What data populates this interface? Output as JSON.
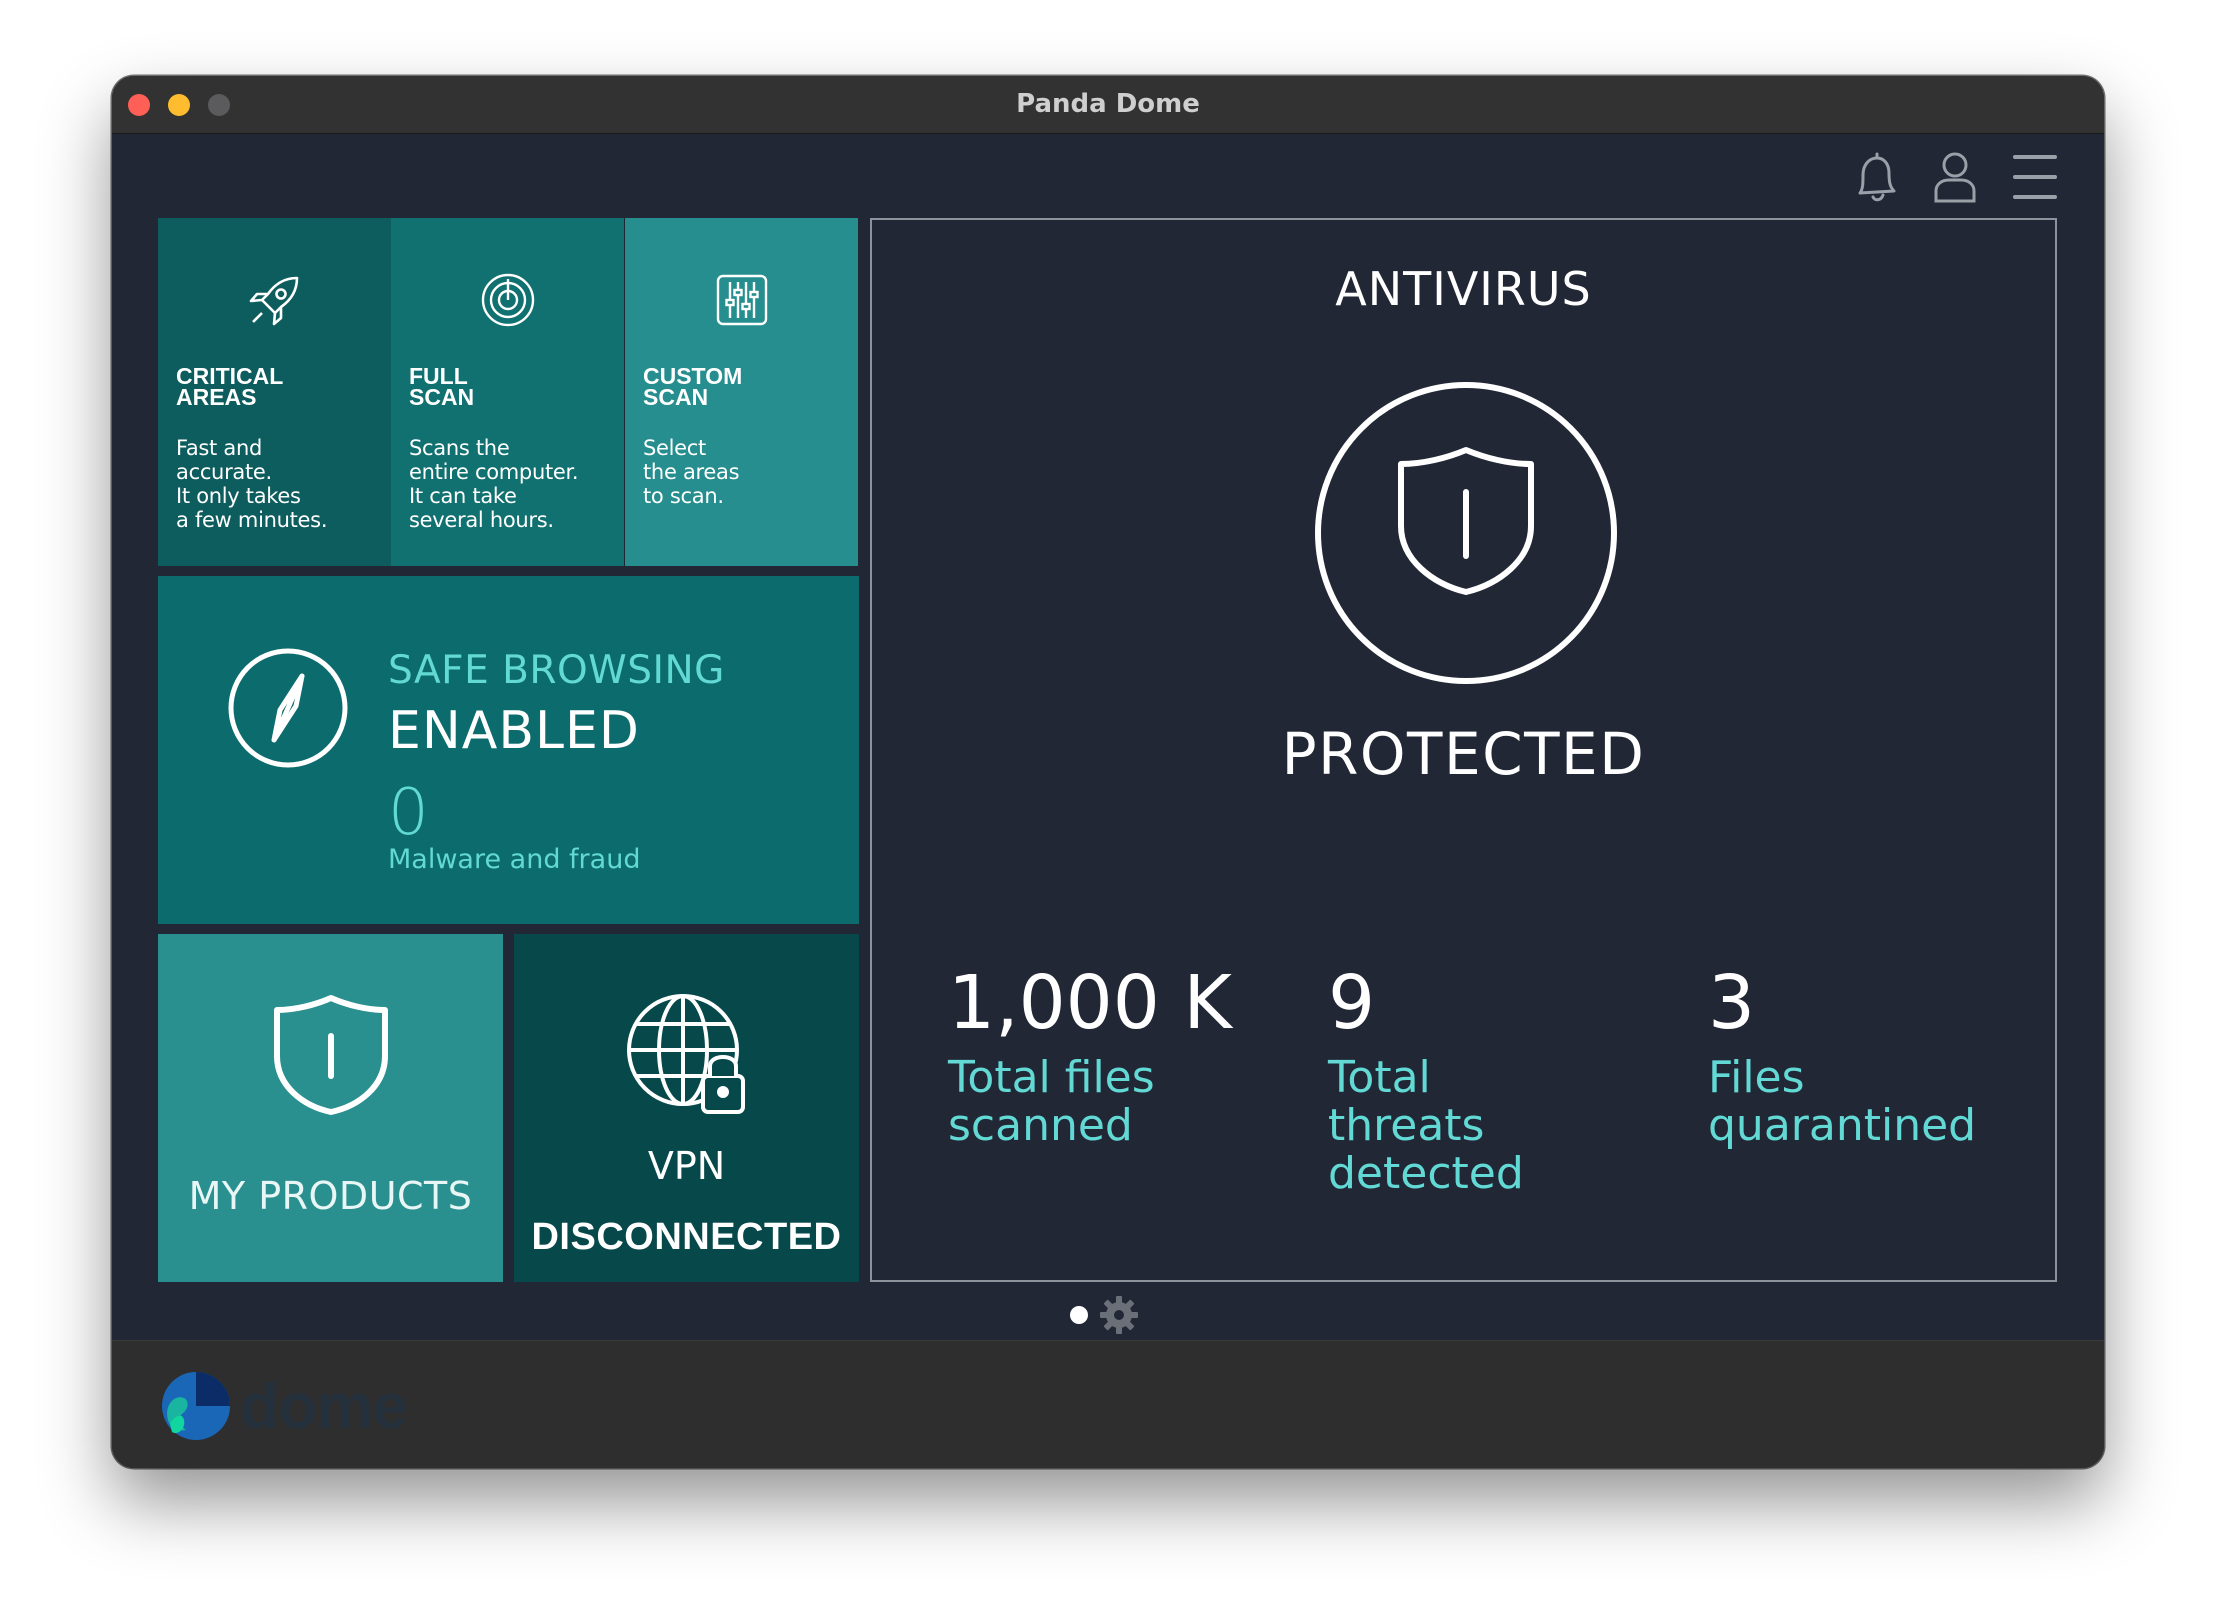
{
  "window": {
    "title": "Panda Dome"
  },
  "toolbar": {
    "icons": [
      "bell-icon",
      "user-icon",
      "menu-icon"
    ]
  },
  "scans": [
    {
      "title": "CRITICAL\nAREAS",
      "description": "Fast and\naccurate.\nIt only takes\na few minutes.",
      "icon": "rocket-icon"
    },
    {
      "title": "FULL\nSCAN",
      "description": "Scans the\nentire computer.\nIt can take\nseveral hours.",
      "icon": "target-icon"
    },
    {
      "title": "CUSTOM\nSCAN",
      "description": "Select\nthe areas\nto scan.",
      "icon": "sliders-icon"
    }
  ],
  "safe_browsing": {
    "label": "SAFE BROWSING",
    "status": "ENABLED",
    "count": "0",
    "count_label": "Malware and fraud",
    "icon": "compass-icon"
  },
  "products": {
    "label": "MY PRODUCTS",
    "icon": "shield-icon"
  },
  "vpn": {
    "label": "VPN",
    "status": "DISCONNECTED",
    "icon": "globe-lock-icon"
  },
  "antivirus": {
    "title": "ANTIVIRUS",
    "status": "PROTECTED",
    "icon": "shield-circle-icon",
    "stats": [
      {
        "value": "1,000 K",
        "label": "Total files\nscanned"
      },
      {
        "value": "9",
        "label": "Total\nthreats\ndetected"
      },
      {
        "value": "3",
        "label": "Files\nquarantined"
      }
    ]
  },
  "footer": {
    "logo_text": "dome"
  },
  "colors": {
    "background": "#212735",
    "accent": "#62d9d5",
    "tile_dark": "#07484a",
    "tile_mid": "#0b6b6d",
    "tile_light": "#2a8f8f"
  }
}
